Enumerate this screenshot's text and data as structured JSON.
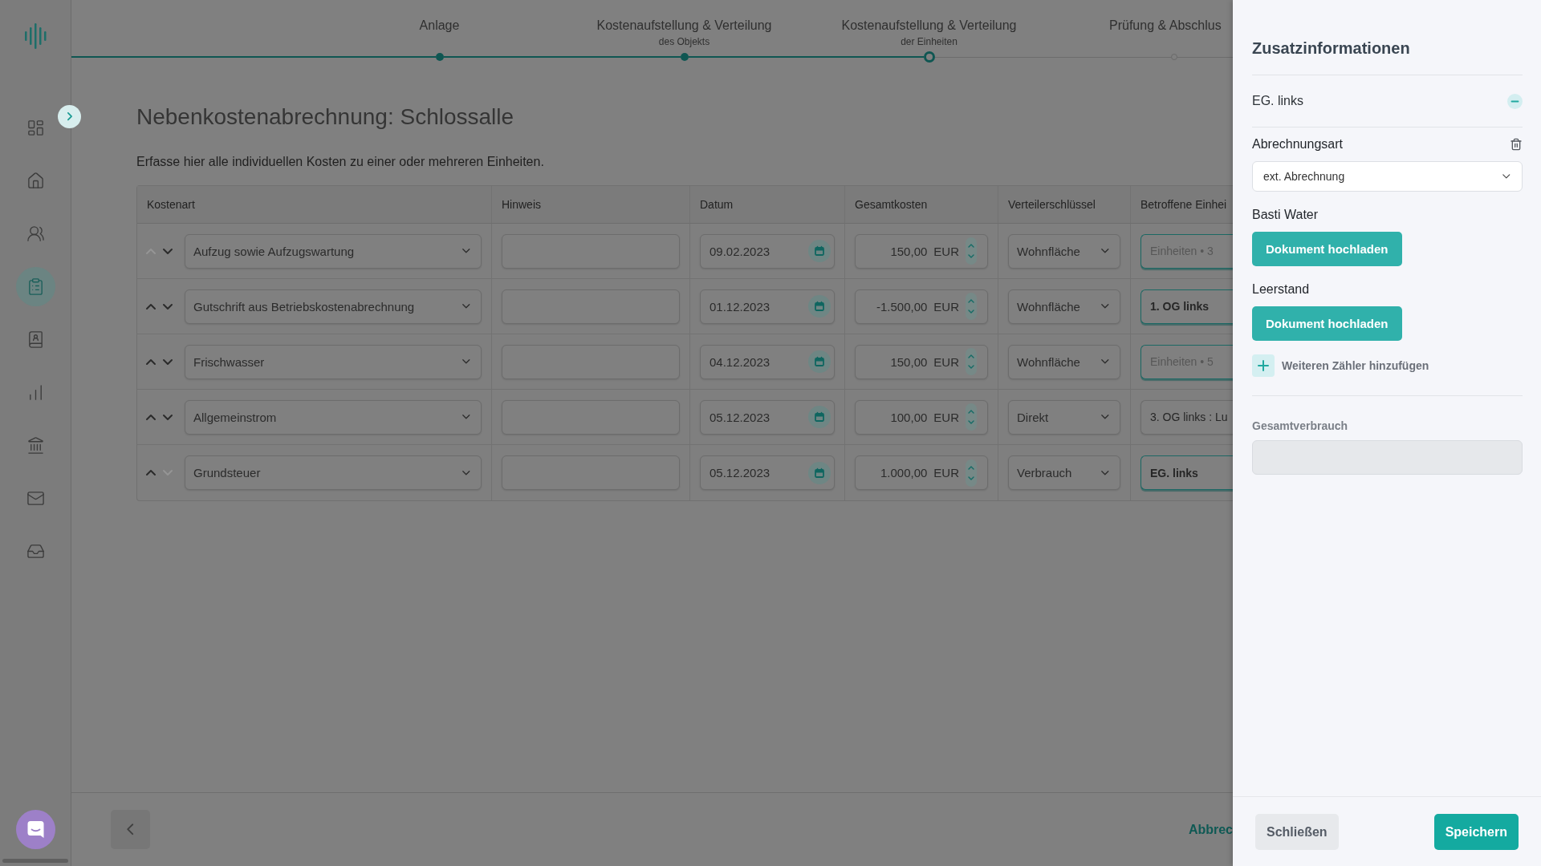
{
  "sidebar": {
    "items": [
      {
        "selected": false
      },
      {
        "selected": false
      },
      {
        "selected": false
      },
      {
        "selected": true
      },
      {
        "selected": false
      },
      {
        "selected": false
      },
      {
        "selected": false
      },
      {
        "selected": false
      },
      {
        "selected": false
      }
    ]
  },
  "wizard": {
    "steps": [
      {
        "title": "Anlage",
        "completed": true,
        "selected": false
      },
      {
        "title": "Kostenaufstellung & Verteilung",
        "subtitle": "des Objekts",
        "completed": true,
        "selected": false
      },
      {
        "title": "Kostenaufstellung & Verteilung",
        "subtitle": "der Einheiten",
        "completed": false,
        "selected": true
      },
      {
        "title": "Prüfung & Abschlus",
        "completed": false,
        "selected": false
      }
    ]
  },
  "page": {
    "title": "Nebenkostenabrechnung: Schlossalle",
    "description": "Erfasse hier alle individuellen Kosten zu einer oder mehreren Einheiten."
  },
  "table": {
    "columns": [
      "Kostenart",
      "Hinweis",
      "Datum",
      "Gesamtkosten",
      "Verteilerschlüssel",
      "Betroffene Einhei"
    ],
    "rows": [
      {
        "move_up_disabled": true,
        "move_down_disabled": false,
        "cost_type": "Aufzug sowie Aufzugswartung",
        "date": "09.02.2023",
        "amount": "150,00",
        "currency": "EUR",
        "key": "Wohnfläche",
        "units": {
          "placeholder": "Einheiten • 3",
          "highlighted": true
        }
      },
      {
        "move_up_disabled": false,
        "move_down_disabled": false,
        "cost_type": "Gutschrift aus Betriebskostenabrechnung",
        "date": "01.12.2023",
        "amount": "-1.500,00",
        "currency": "EUR",
        "key": "Wohnfläche",
        "units": {
          "value": "1. OG links",
          "highlighted": true
        }
      },
      {
        "move_up_disabled": false,
        "move_down_disabled": false,
        "cost_type": "Frischwasser",
        "date": "04.12.2023",
        "amount": "150,00",
        "currency": "EUR",
        "key": "Wohnfläche",
        "units": {
          "placeholder": "Einheiten • 5",
          "highlighted": true
        }
      },
      {
        "move_up_disabled": false,
        "move_down_disabled": false,
        "cost_type": "Allgemeinstrom",
        "date": "05.12.2023",
        "amount": "100,00",
        "currency": "EUR",
        "key": "Direkt",
        "units": {
          "value": "3. OG links : Lu",
          "highlighted": false
        }
      },
      {
        "move_up_disabled": false,
        "move_down_disabled": true,
        "cost_type": "Grundsteuer",
        "date": "05.12.2023",
        "amount": "1.000,00",
        "currency": "EUR",
        "key": "Verbrauch",
        "units": {
          "value": "EG. links",
          "highlighted": true
        }
      }
    ]
  },
  "footer": {
    "cancel": "Abbrec"
  },
  "panel": {
    "title": "Zusatzinformationen",
    "unit": {
      "name": "EG. links",
      "expanded": true
    },
    "billing": {
      "label": "Abrechnungsart",
      "value": "ext. Abrechnung"
    },
    "meters": [
      {
        "name": "Basti Water",
        "button": "Dokument hochladen"
      },
      {
        "name": "Leerstand",
        "button": "Dokument hochladen"
      }
    ],
    "add_meter": "Weiteren Zähler hinzufügen",
    "total": {
      "label": "Gesamtverbrauch",
      "disabled": true
    },
    "buttons": [
      {
        "label": "Schließen",
        "kind": "secondary"
      },
      {
        "label": "Speichern",
        "kind": "primary"
      }
    ]
  }
}
